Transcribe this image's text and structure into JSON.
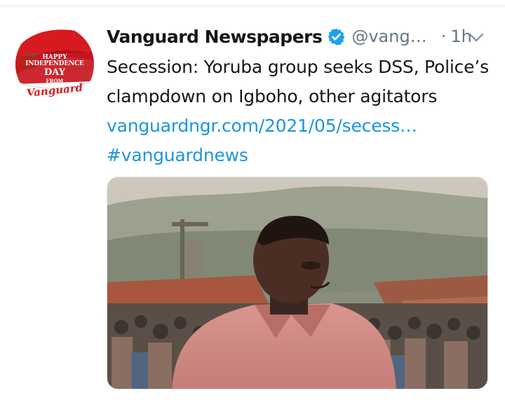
{
  "tweet": {
    "avatar": {
      "line1": "HAPPY",
      "line2": "INDEPENDENCE",
      "line3": "DAY",
      "line4": "FROM",
      "brand": "Vanguard"
    },
    "display_name": "Vanguard Newspapers",
    "verified_icon": "verified-badge-icon",
    "handle": "@vang…",
    "separator": "·",
    "timestamp": "1h",
    "menu_icon": "chevron-down-icon",
    "text_lines": [
      "Secession: Yoruba group seeks DSS, Police’s",
      "clampdown on Igboho, other agitators"
    ],
    "link": "vanguardngr.com/2021/05/secess…",
    "hashtag": "#vanguardnews",
    "media": {
      "type": "photo",
      "description_icon": "news-photo"
    }
  },
  "colors": {
    "text": "#14171a",
    "muted": "#657786",
    "link": "#1b95e0",
    "verified": "#1da1f2",
    "brand_red": "#d71920",
    "brand_green": "#1f8a3b"
  }
}
